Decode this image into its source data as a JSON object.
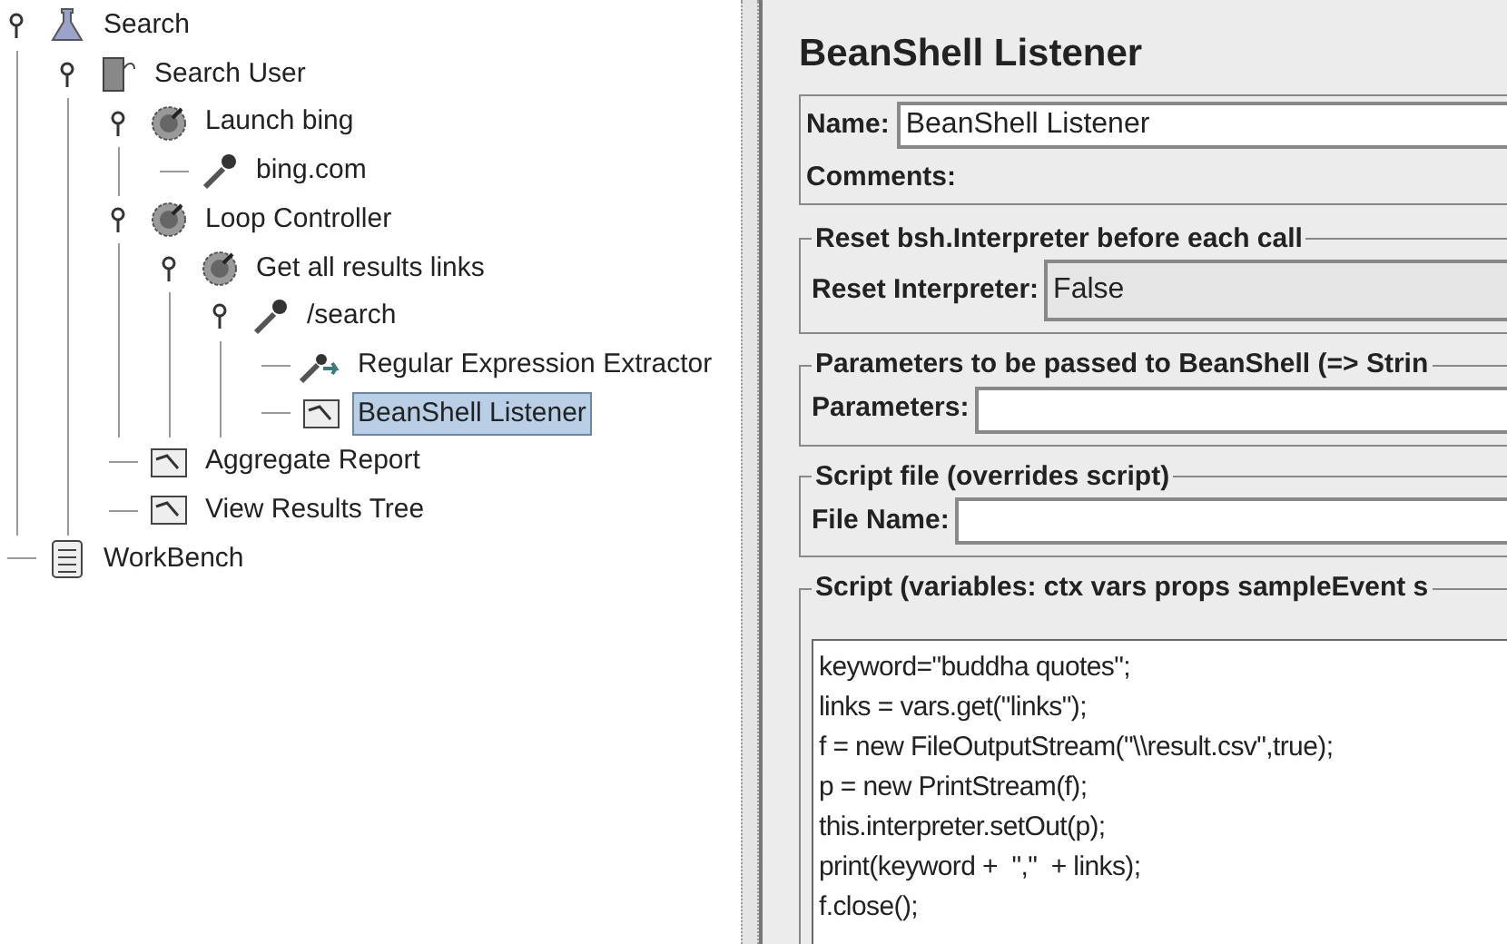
{
  "tree": [
    {
      "label": "Search",
      "kind": "testplan",
      "selected": false,
      "expanded": true,
      "children": [
        {
          "label": "Search User",
          "kind": "threadgroup",
          "selected": false,
          "expanded": true,
          "children": [
            {
              "label": "Launch bing",
              "kind": "controller",
              "selected": false,
              "expanded": true,
              "children": [
                {
                  "label": "bing.com",
                  "kind": "sampler",
                  "selected": false
                }
              ]
            },
            {
              "label": "Loop Controller",
              "kind": "controller",
              "selected": false,
              "expanded": true,
              "children": [
                {
                  "label": "Get all results links",
                  "kind": "controller",
                  "selected": false,
                  "expanded": true,
                  "children": [
                    {
                      "label": "/search",
                      "kind": "sampler",
                      "selected": false,
                      "expanded": true,
                      "children": [
                        {
                          "label": "Regular Expression Extractor",
                          "kind": "extractor",
                          "selected": false
                        },
                        {
                          "label": "BeanShell Listener",
                          "kind": "listener",
                          "selected": true
                        }
                      ]
                    }
                  ]
                }
              ]
            },
            {
              "label": "Aggregate Report",
              "kind": "listener",
              "selected": false
            },
            {
              "label": "View Results Tree",
              "kind": "listener",
              "selected": false
            }
          ]
        }
      ]
    },
    {
      "label": "WorkBench",
      "kind": "workbench",
      "selected": false
    }
  ],
  "panel": {
    "title": "BeanShell Listener",
    "name_label": "Name:",
    "name_value": "BeanShell Listener",
    "comments_label": "Comments:",
    "reset_group": {
      "legend": "Reset bsh.Interpreter before each call",
      "label": "Reset Interpreter:",
      "value": "False"
    },
    "parameters_group": {
      "legend": "Parameters to be passed to BeanShell (=> Strin",
      "label": "Parameters:"
    },
    "file_group": {
      "legend": "Script file (overrides script)",
      "label": "File Name:"
    },
    "script_group": {
      "legend": "Script (variables: ctx vars props sampleEvent s",
      "lines": [
        "keyword=\"buddha quotes\";",
        "links = vars.get(\"links\");",
        "f = new FileOutputStream(\"\\\\result.csv\",true);",
        "p = new PrintStream(f);",
        "this.interpreter.setOut(p);",
        "print(keyword +  \",\"  + links);",
        "f.close();"
      ]
    }
  }
}
